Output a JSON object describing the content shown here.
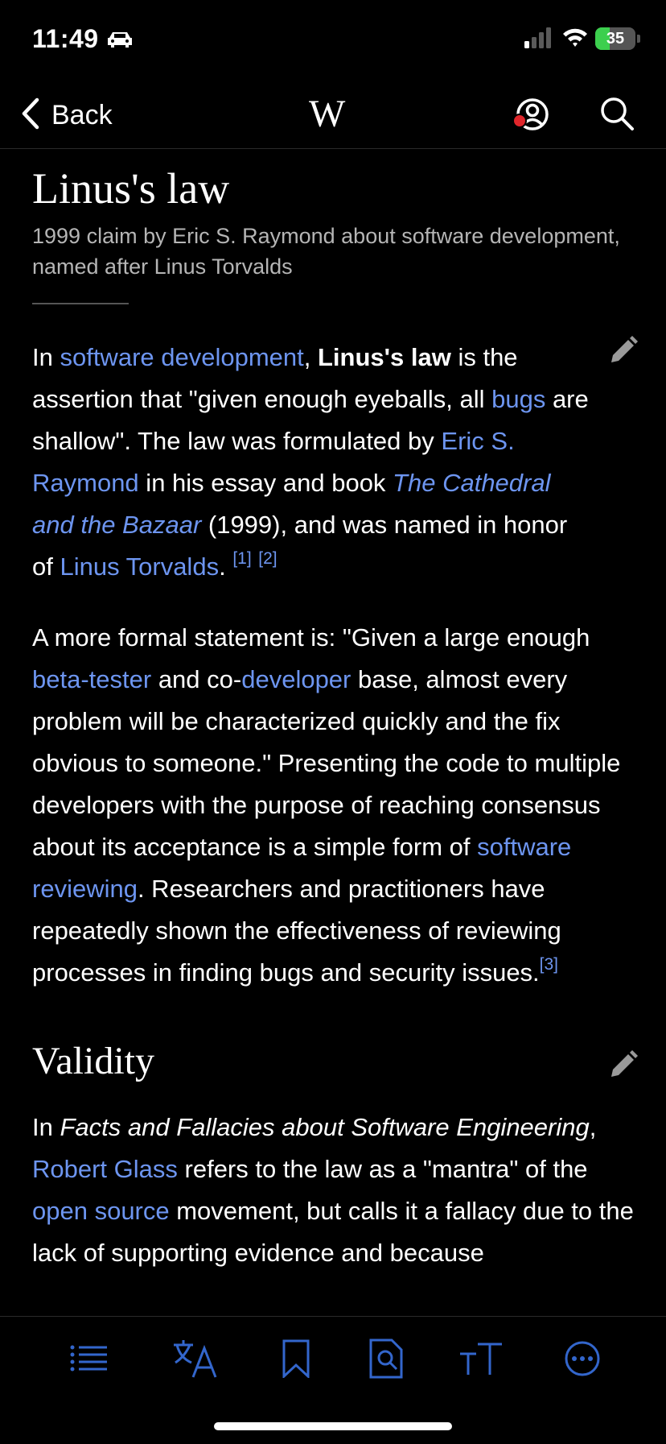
{
  "status_bar": {
    "time": "11:49",
    "battery": "35",
    "battery_level": 0.35
  },
  "nav": {
    "back_label": "Back",
    "logo": "W"
  },
  "article": {
    "title": "Linus's law",
    "description": "1999 claim by Eric S. Raymond about software development, named after Linus Torvalds",
    "p1": {
      "t1": "In ",
      "link_software_development": "software development",
      "t2": ", ",
      "bold": "Linus's law",
      "t3": " is the assertion that \"given enough eyeballs, all ",
      "link_bugs": "bugs",
      "t4": " are shallow\". The law was formulated by ",
      "link_raymond": "Eric S. Raymond",
      "t5": " in his essay and book ",
      "link_book": "The Cathedral and the Bazaar",
      "t6": " (1999), and was named in honor of ",
      "link_torvalds": "Linus Torvalds",
      "t7": ". ",
      "ref1": "[1]",
      "ref2": "[2]"
    },
    "p2": {
      "t1": "A more formal statement is: \"Given a large enough ",
      "link_beta": "beta-tester",
      "t2": " and co-",
      "link_developer": "developer",
      "t3": " base, almost every problem will be characterized quickly and the fix obvious to someone.\" Presenting the code to multiple developers with the purpose of reaching consensus about its acceptance is a simple form of ",
      "link_reviewing": "software reviewing",
      "t4": ". Researchers and practitioners have repeatedly shown the effectiveness of reviewing processes in finding bugs and security issues.",
      "ref3": "[3]"
    },
    "section_validity": {
      "heading": "Validity",
      "t1": "In ",
      "italic": "Facts and Fallacies about Software Engineering",
      "t2": ", ",
      "link_glass": "Robert Glass",
      "t3": " refers to the law as a \"mantra\" of the ",
      "link_open_source": "open source",
      "t4": " movement, but calls it a fallacy due to the lack of supporting evidence and because"
    }
  },
  "toolbar_icons": [
    "contents-icon",
    "language-icon",
    "bookmark-icon",
    "find-in-page-icon",
    "text-size-icon",
    "more-icon"
  ],
  "colors": {
    "background": "#000000",
    "link": "#6d95f0",
    "secondary_text": "#b5b5b5",
    "toolbar_icon": "#3366cc",
    "battery_green": "#3ccf4e",
    "notification_dot": "#e0262b"
  }
}
